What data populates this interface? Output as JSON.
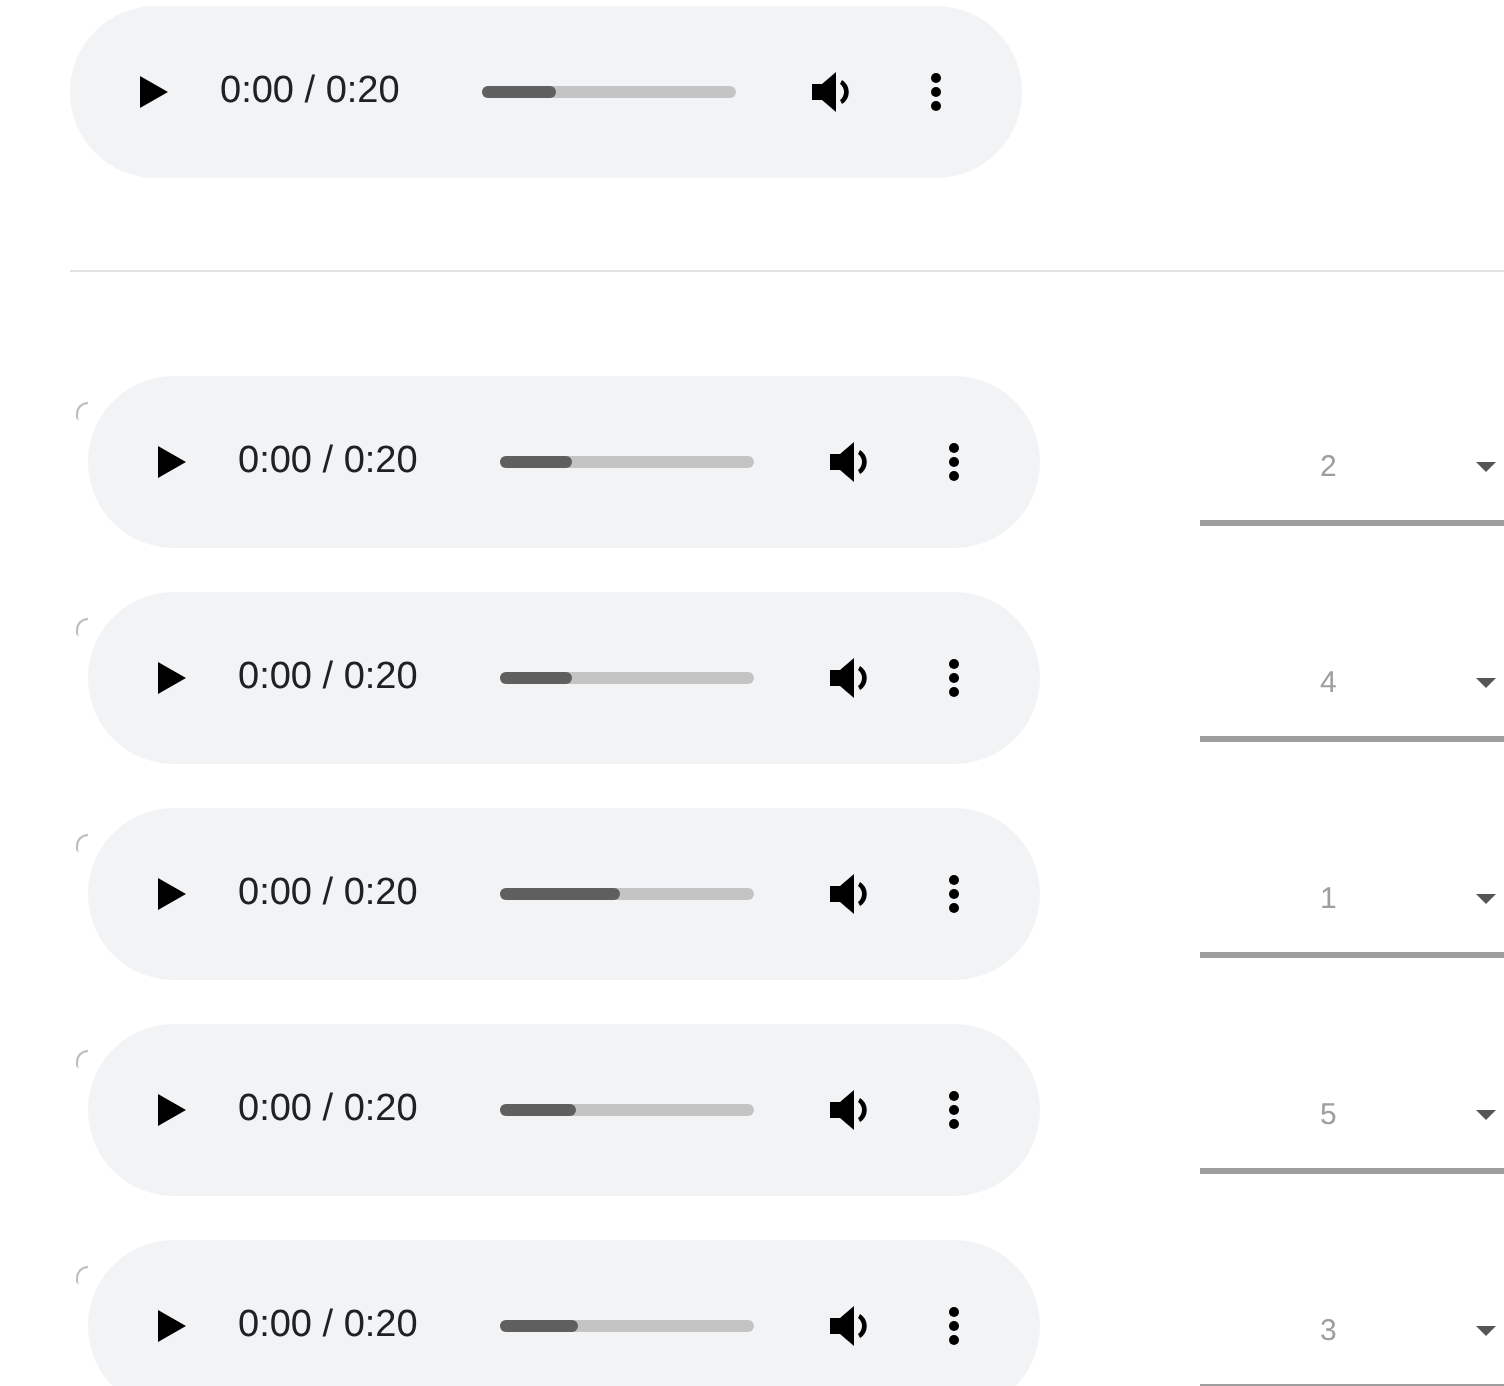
{
  "main_player": {
    "time": "0:00 / 0:20",
    "level": 0.29
  },
  "rows": [
    {
      "radio_selected": false,
      "player": {
        "time": "0:00 / 0:20",
        "level": 0.28
      },
      "dropdown": {
        "value": "2"
      }
    },
    {
      "radio_selected": false,
      "player": {
        "time": "0:00 / 0:20",
        "level": 0.28
      },
      "dropdown": {
        "value": "4"
      }
    },
    {
      "radio_selected": false,
      "player": {
        "time": "0:00 / 0:20",
        "level": 0.47
      },
      "dropdown": {
        "value": "1"
      }
    },
    {
      "radio_selected": false,
      "player": {
        "time": "0:00 / 0:20",
        "level": 0.3
      },
      "dropdown": {
        "value": "5"
      }
    },
    {
      "radio_selected": false,
      "player": {
        "time": "0:00 / 0:20",
        "level": 0.31
      },
      "dropdown": {
        "value": "3"
      }
    }
  ]
}
